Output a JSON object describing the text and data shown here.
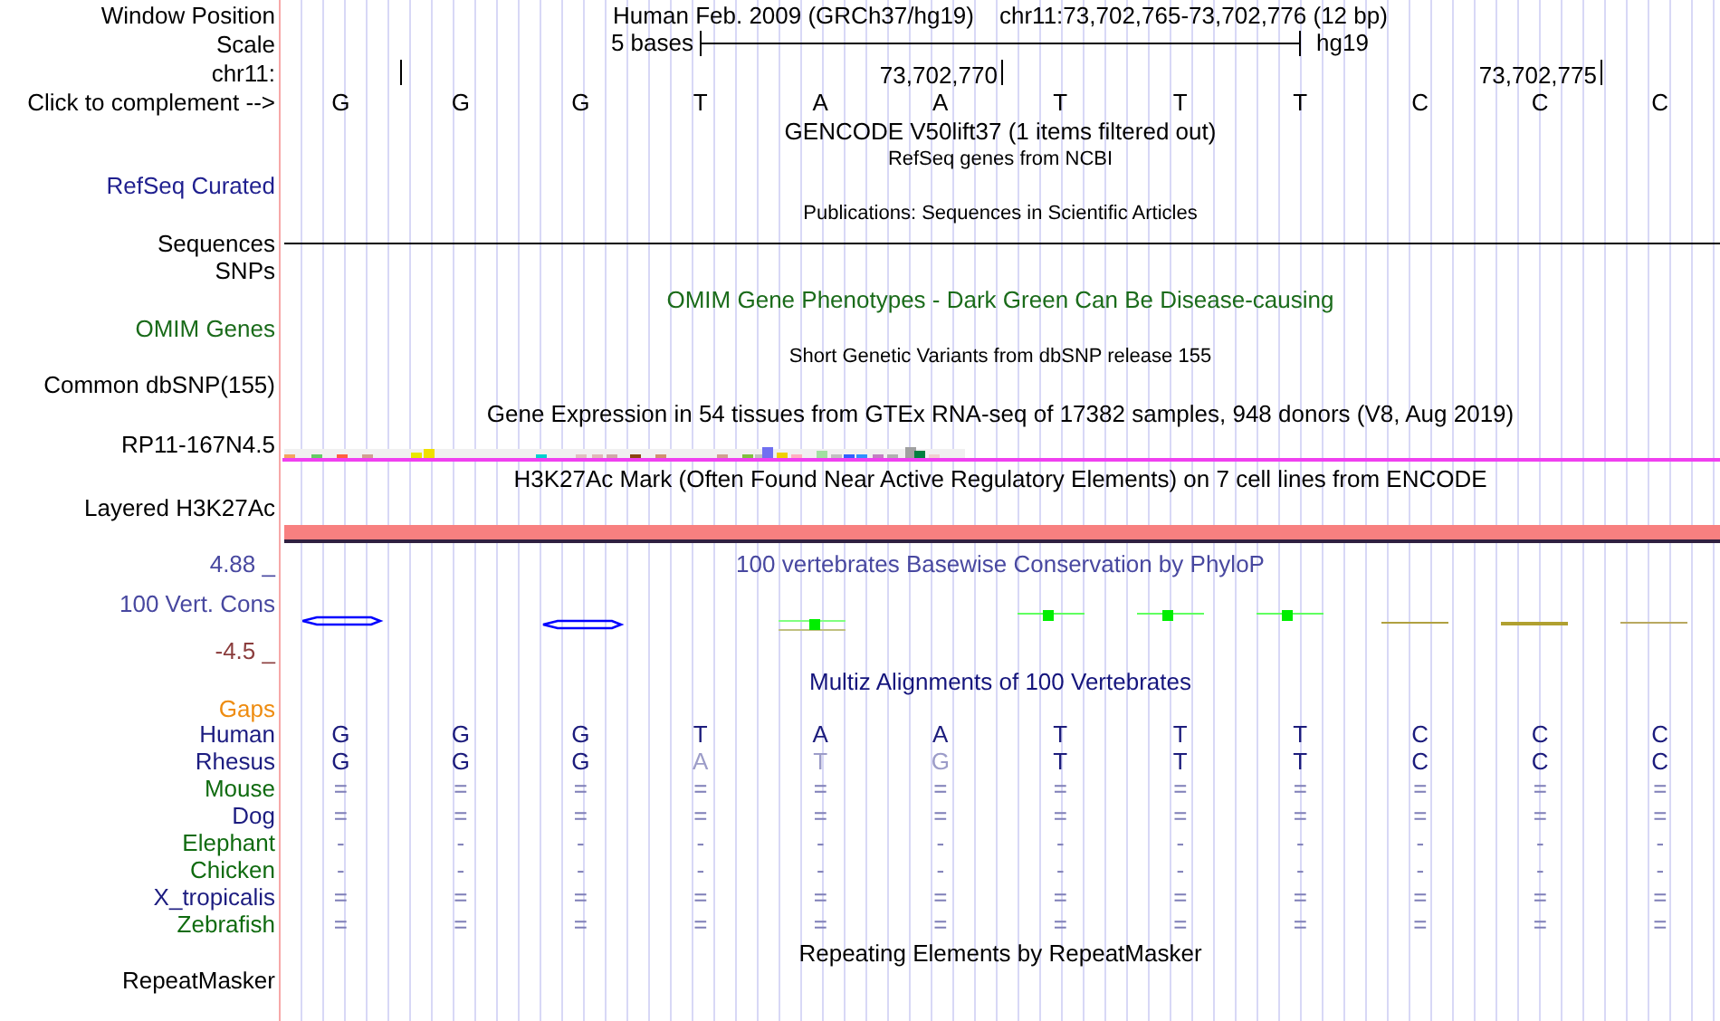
{
  "header": {
    "label": "Window Position",
    "assembly_title": "Human Feb. 2009 (GRCh37/hg19)",
    "position": "chr11:73,702,765-73,702,776 (12 bp)"
  },
  "scale": {
    "label": "Scale",
    "text": "5 bases",
    "assembly": "hg19"
  },
  "coordinates": {
    "label": "chr11:",
    "ticks": [
      "73,702,770",
      "73,702,775"
    ]
  },
  "complement": {
    "label": "Click to complement -->",
    "bases": [
      "G",
      "G",
      "G",
      "T",
      "A",
      "A",
      "T",
      "T",
      "T",
      "C",
      "C",
      "C"
    ]
  },
  "gencode": {
    "title": "GENCODE V50lift37 (1 items filtered out)"
  },
  "refseq": {
    "title": "RefSeq genes from NCBI",
    "label": "RefSeq Curated"
  },
  "publications": {
    "title": "Publications: Sequences in Scientific Articles"
  },
  "sequences": {
    "label": "Sequences"
  },
  "snps": {
    "label": "SNPs"
  },
  "omim": {
    "title": "OMIM Gene Phenotypes - Dark Green Can Be Disease-causing",
    "label": "OMIM Genes"
  },
  "dbsnp": {
    "title": "Short Genetic Variants from dbSNP release 155",
    "label": "Common dbSNP(155)"
  },
  "gtex": {
    "title": "Gene Expression in 54 tissues from GTEx RNA-seq of 17382 samples, 948 donors (V8, Aug 2019)",
    "label": "RP11-167N4.5"
  },
  "h3k27ac": {
    "title": "H3K27Ac Mark (Often Found Near Active Regulatory Elements) on 7 cell lines from ENCODE",
    "label": "Layered H3K27Ac"
  },
  "phylop": {
    "title": "100 vertebrates Basewise Conservation by PhyloP",
    "label": "100 Vert. Cons",
    "max": "4.88 _",
    "min": "-4.5 _"
  },
  "multiz": {
    "title": "Multiz Alignments of 100 Vertebrates",
    "gaps_label": "Gaps",
    "species": [
      {
        "name": "Human",
        "color": "#1c1c80",
        "kind": "sequence",
        "bases": [
          {
            "text": "G",
            "faded": false
          },
          {
            "text": "G",
            "faded": false
          },
          {
            "text": "G",
            "faded": false
          },
          {
            "text": "T",
            "faded": false
          },
          {
            "text": "A",
            "faded": false
          },
          {
            "text": "A",
            "faded": false
          },
          {
            "text": "T",
            "faded": false
          },
          {
            "text": "T",
            "faded": false
          },
          {
            "text": "T",
            "faded": false
          },
          {
            "text": "C",
            "faded": false
          },
          {
            "text": "C",
            "faded": false
          },
          {
            "text": "C",
            "faded": false
          }
        ]
      },
      {
        "name": "Rhesus",
        "color": "#1c1c80",
        "kind": "sequence",
        "bases": [
          {
            "text": "G",
            "faded": false
          },
          {
            "text": "G",
            "faded": false
          },
          {
            "text": "G",
            "faded": false
          },
          {
            "text": "A",
            "faded": true
          },
          {
            "text": "T",
            "faded": true
          },
          {
            "text": "G",
            "faded": true
          },
          {
            "text": "T",
            "faded": false
          },
          {
            "text": "T",
            "faded": false
          },
          {
            "text": "T",
            "faded": false
          },
          {
            "text": "C",
            "faded": false
          },
          {
            "text": "C",
            "faded": false
          },
          {
            "text": "C",
            "faded": false
          }
        ]
      },
      {
        "name": "Mouse",
        "color": "#106b10",
        "kind": "match",
        "bases": [
          "=",
          "=",
          "=",
          "=",
          "=",
          "=",
          "=",
          "=",
          "=",
          "=",
          "=",
          "="
        ]
      },
      {
        "name": "Dog",
        "color": "#1c1c80",
        "kind": "match",
        "bases": [
          "=",
          "=",
          "=",
          "=",
          "=",
          "=",
          "=",
          "=",
          "=",
          "=",
          "=",
          "="
        ]
      },
      {
        "name": "Elephant",
        "color": "#106b10",
        "kind": "match",
        "bases": [
          "-",
          "-",
          "-",
          "-",
          "-",
          "-",
          "-",
          "-",
          "-",
          "-",
          "-",
          "-"
        ]
      },
      {
        "name": "Chicken",
        "color": "#106b10",
        "kind": "match",
        "bases": [
          "-",
          "-",
          "-",
          "-",
          "-",
          "-",
          "-",
          "-",
          "-",
          "-",
          "-",
          "-"
        ]
      },
      {
        "name": "X_tropicalis",
        "color": "#1c1c80",
        "kind": "match",
        "bases": [
          "=",
          "=",
          "=",
          "=",
          "=",
          "=",
          "=",
          "=",
          "=",
          "=",
          "=",
          "="
        ]
      },
      {
        "name": "Zebrafish",
        "color": "#106b10",
        "kind": "match",
        "bases": [
          "=",
          "=",
          "=",
          "=",
          "=",
          "=",
          "=",
          "=",
          "=",
          "=",
          "=",
          "="
        ]
      }
    ]
  },
  "repeatmasker": {
    "title": "Repeating Elements by RepeatMasker",
    "label": "RepeatMasker"
  }
}
